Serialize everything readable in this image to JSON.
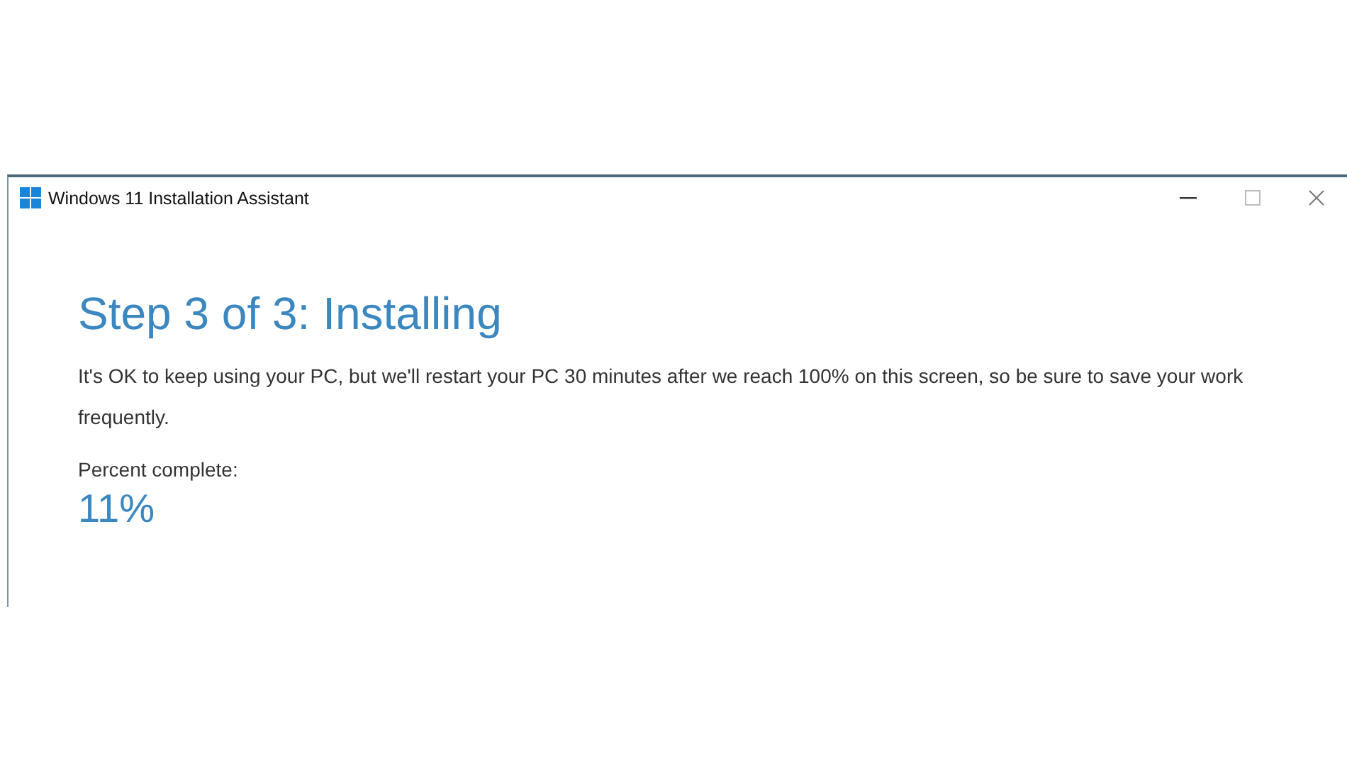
{
  "window": {
    "title": "Windows 11 Installation Assistant"
  },
  "heading": "Step 3 of 3: Installing",
  "message": "It's OK to keep using your PC, but we'll restart your PC 30 minutes after we reach 100% on this screen, so be sure to save your work frequently.",
  "progress": {
    "label": "Percent complete:",
    "value": "11%"
  }
}
